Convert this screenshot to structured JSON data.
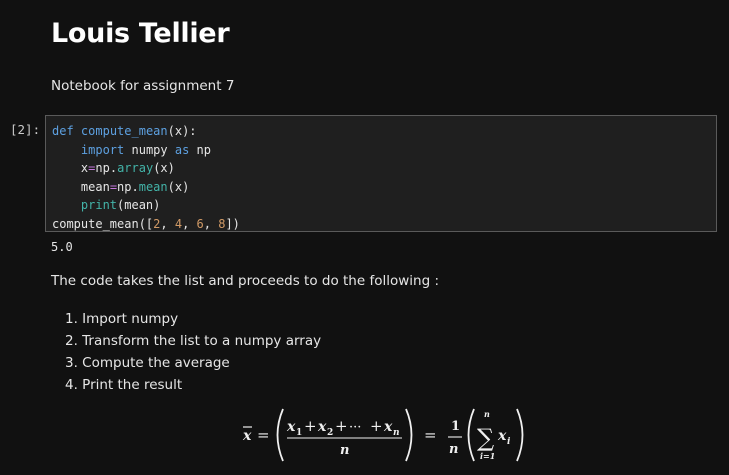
{
  "heading": {
    "title": "Louis Tellier",
    "subtitle": "Notebook for assignment 7"
  },
  "cell": {
    "prompt": "[2]:",
    "code": {
      "l1_kw": "def",
      "l1_fn": "compute_mean",
      "l1_rest": "(x):",
      "l2_kw": "import",
      "l2_mid": " numpy ",
      "l2_as": "as",
      "l2_rest": " np",
      "l3_a": "x",
      "l3_op": "=",
      "l3_b": "np.",
      "l3_fn": "array",
      "l3_c": "(x)",
      "l4_a": "mean",
      "l4_op": "=",
      "l4_b": "np.",
      "l4_fn": "mean",
      "l4_c": "(x)",
      "l5_fn": "print",
      "l5_c": "(mean)",
      "l6_a": "compute_mean([",
      "l6_n1": "2",
      "l6_s1": ", ",
      "l6_n2": "4",
      "l6_s2": ", ",
      "l6_n3": "6",
      "l6_s3": ", ",
      "l6_n4": "8",
      "l6_end": "])"
    },
    "output": "5.0"
  },
  "explanation": {
    "intro": "The code takes the list and proceeds to do the following :",
    "steps": [
      "1. Import numpy",
      "2. Transform the list to a numpy array",
      "3. Compute the average",
      "4. Print the result"
    ]
  },
  "formula": {
    "lhs": "x",
    "eq1": "=",
    "t1": "x",
    "s1": "1",
    "p1": "+",
    "t2": "x",
    "s2": "2",
    "p2": "+",
    "dots": "···",
    "p3": "+",
    "t3": "x",
    "s3": "n",
    "den": "n",
    "eq2": "=",
    "one": "1",
    "n2": "n",
    "sum_top": "n",
    "sigma": "∑",
    "sum_bot": "i=1",
    "xi": "x",
    "xi_sub": "i"
  }
}
